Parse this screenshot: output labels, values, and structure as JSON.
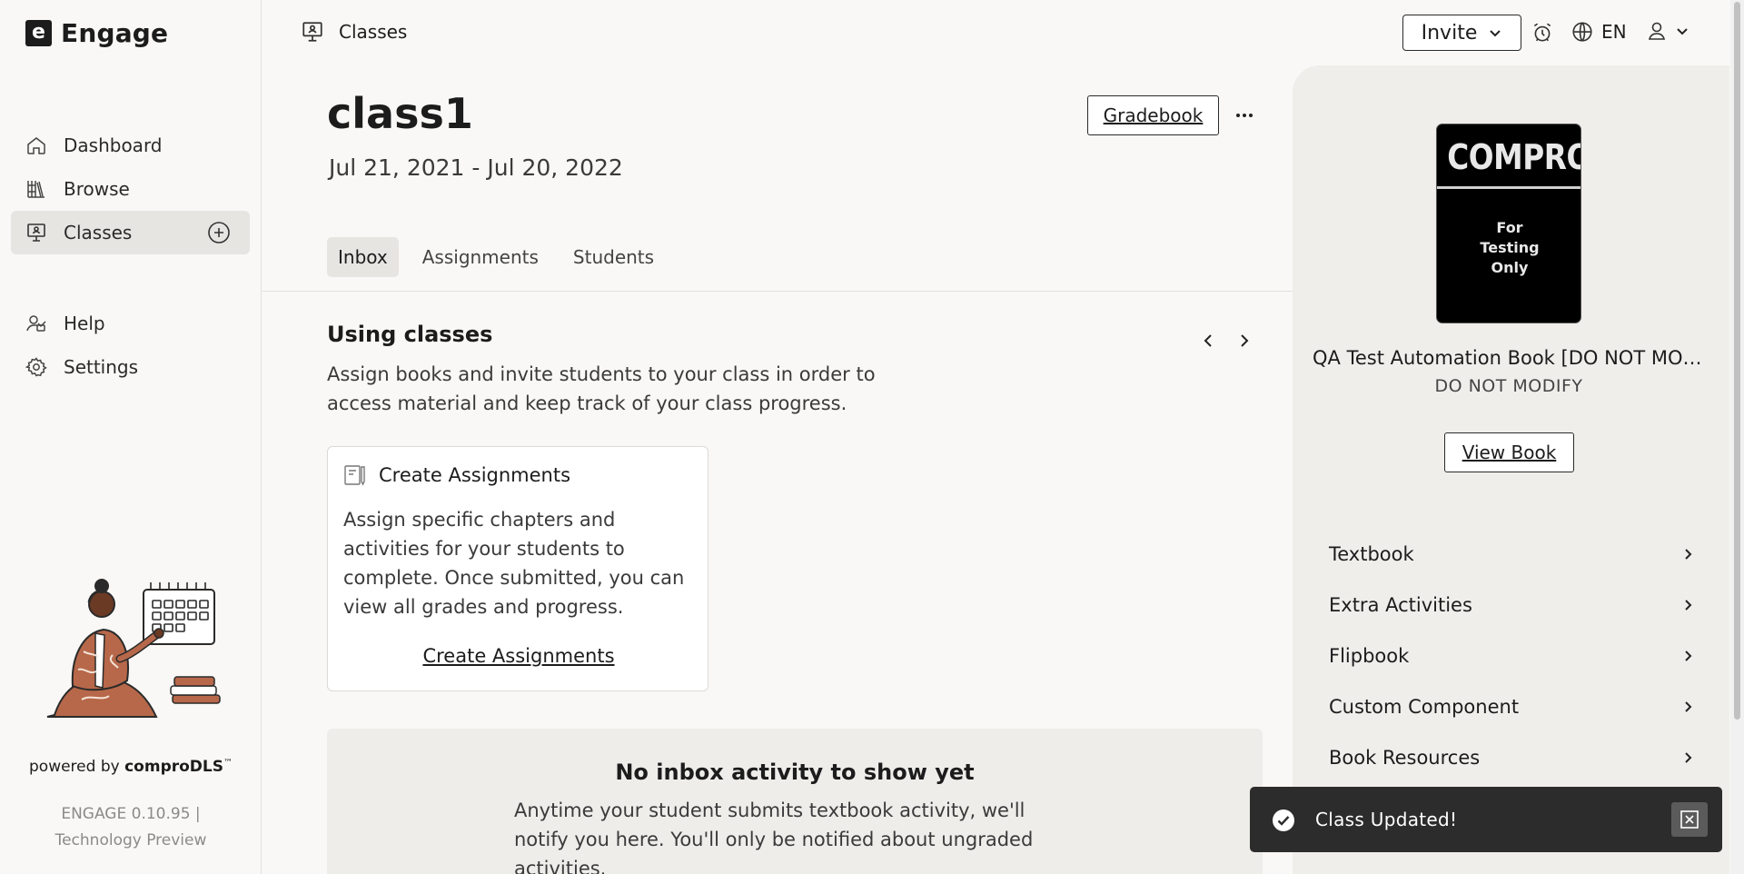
{
  "app": {
    "logo_letter": "e",
    "name": "Engage"
  },
  "sidebar": {
    "items": [
      {
        "label": "Dashboard",
        "icon": "home-icon"
      },
      {
        "label": "Browse",
        "icon": "library-icon"
      },
      {
        "label": "Classes",
        "icon": "classes-icon",
        "active": true
      },
      {
        "label": "Help",
        "icon": "help-icon"
      },
      {
        "label": "Settings",
        "icon": "gear-icon"
      }
    ],
    "powered_prefix": "powered by ",
    "powered_brand": "comproDLS",
    "powered_tm": "™",
    "version_line1": "ENGAGE 0.10.95 |",
    "version_line2": "Technology Preview"
  },
  "topbar": {
    "breadcrumb": "Classes",
    "invite_label": "Invite",
    "language": "EN"
  },
  "class": {
    "name": "class1",
    "dates": "Jul 21, 2021 - Jul 20, 2022",
    "gradebook_label": "Gradebook"
  },
  "tabs": [
    {
      "label": "Inbox",
      "active": true
    },
    {
      "label": "Assignments"
    },
    {
      "label": "Students"
    }
  ],
  "using": {
    "title": "Using classes",
    "description": "Assign books and invite students to your class in order to access material and keep track of your class progress."
  },
  "card": {
    "title": "Create Assignments",
    "body": "Assign specific chapters and activities for your students to complete. Once submitted, you can view all grades and progress.",
    "link": "Create Assignments"
  },
  "empty_state": {
    "title": "No inbox activity to show yet",
    "description": "Anytime your student submits textbook activity, we'll notify you here. You'll only be notified about ungraded activities."
  },
  "book": {
    "cover_title": "COMPRO",
    "cover_line1": "For",
    "cover_line2": "Testing",
    "cover_line3": "Only",
    "name": "QA Test Automation Book [DO NOT MODIFY]",
    "subtitle": "DO NOT MODIFY",
    "view_label": "View Book",
    "resources": [
      "Textbook",
      "Extra Activities",
      "Flipbook",
      "Custom Component",
      "Book Resources"
    ]
  },
  "toast": {
    "message": "Class Updated!"
  },
  "colors": {
    "accent": "#1c1c1c",
    "background": "#f9f8f6",
    "panel": "#efeeeb",
    "toast_bg": "#2c2c2c"
  }
}
